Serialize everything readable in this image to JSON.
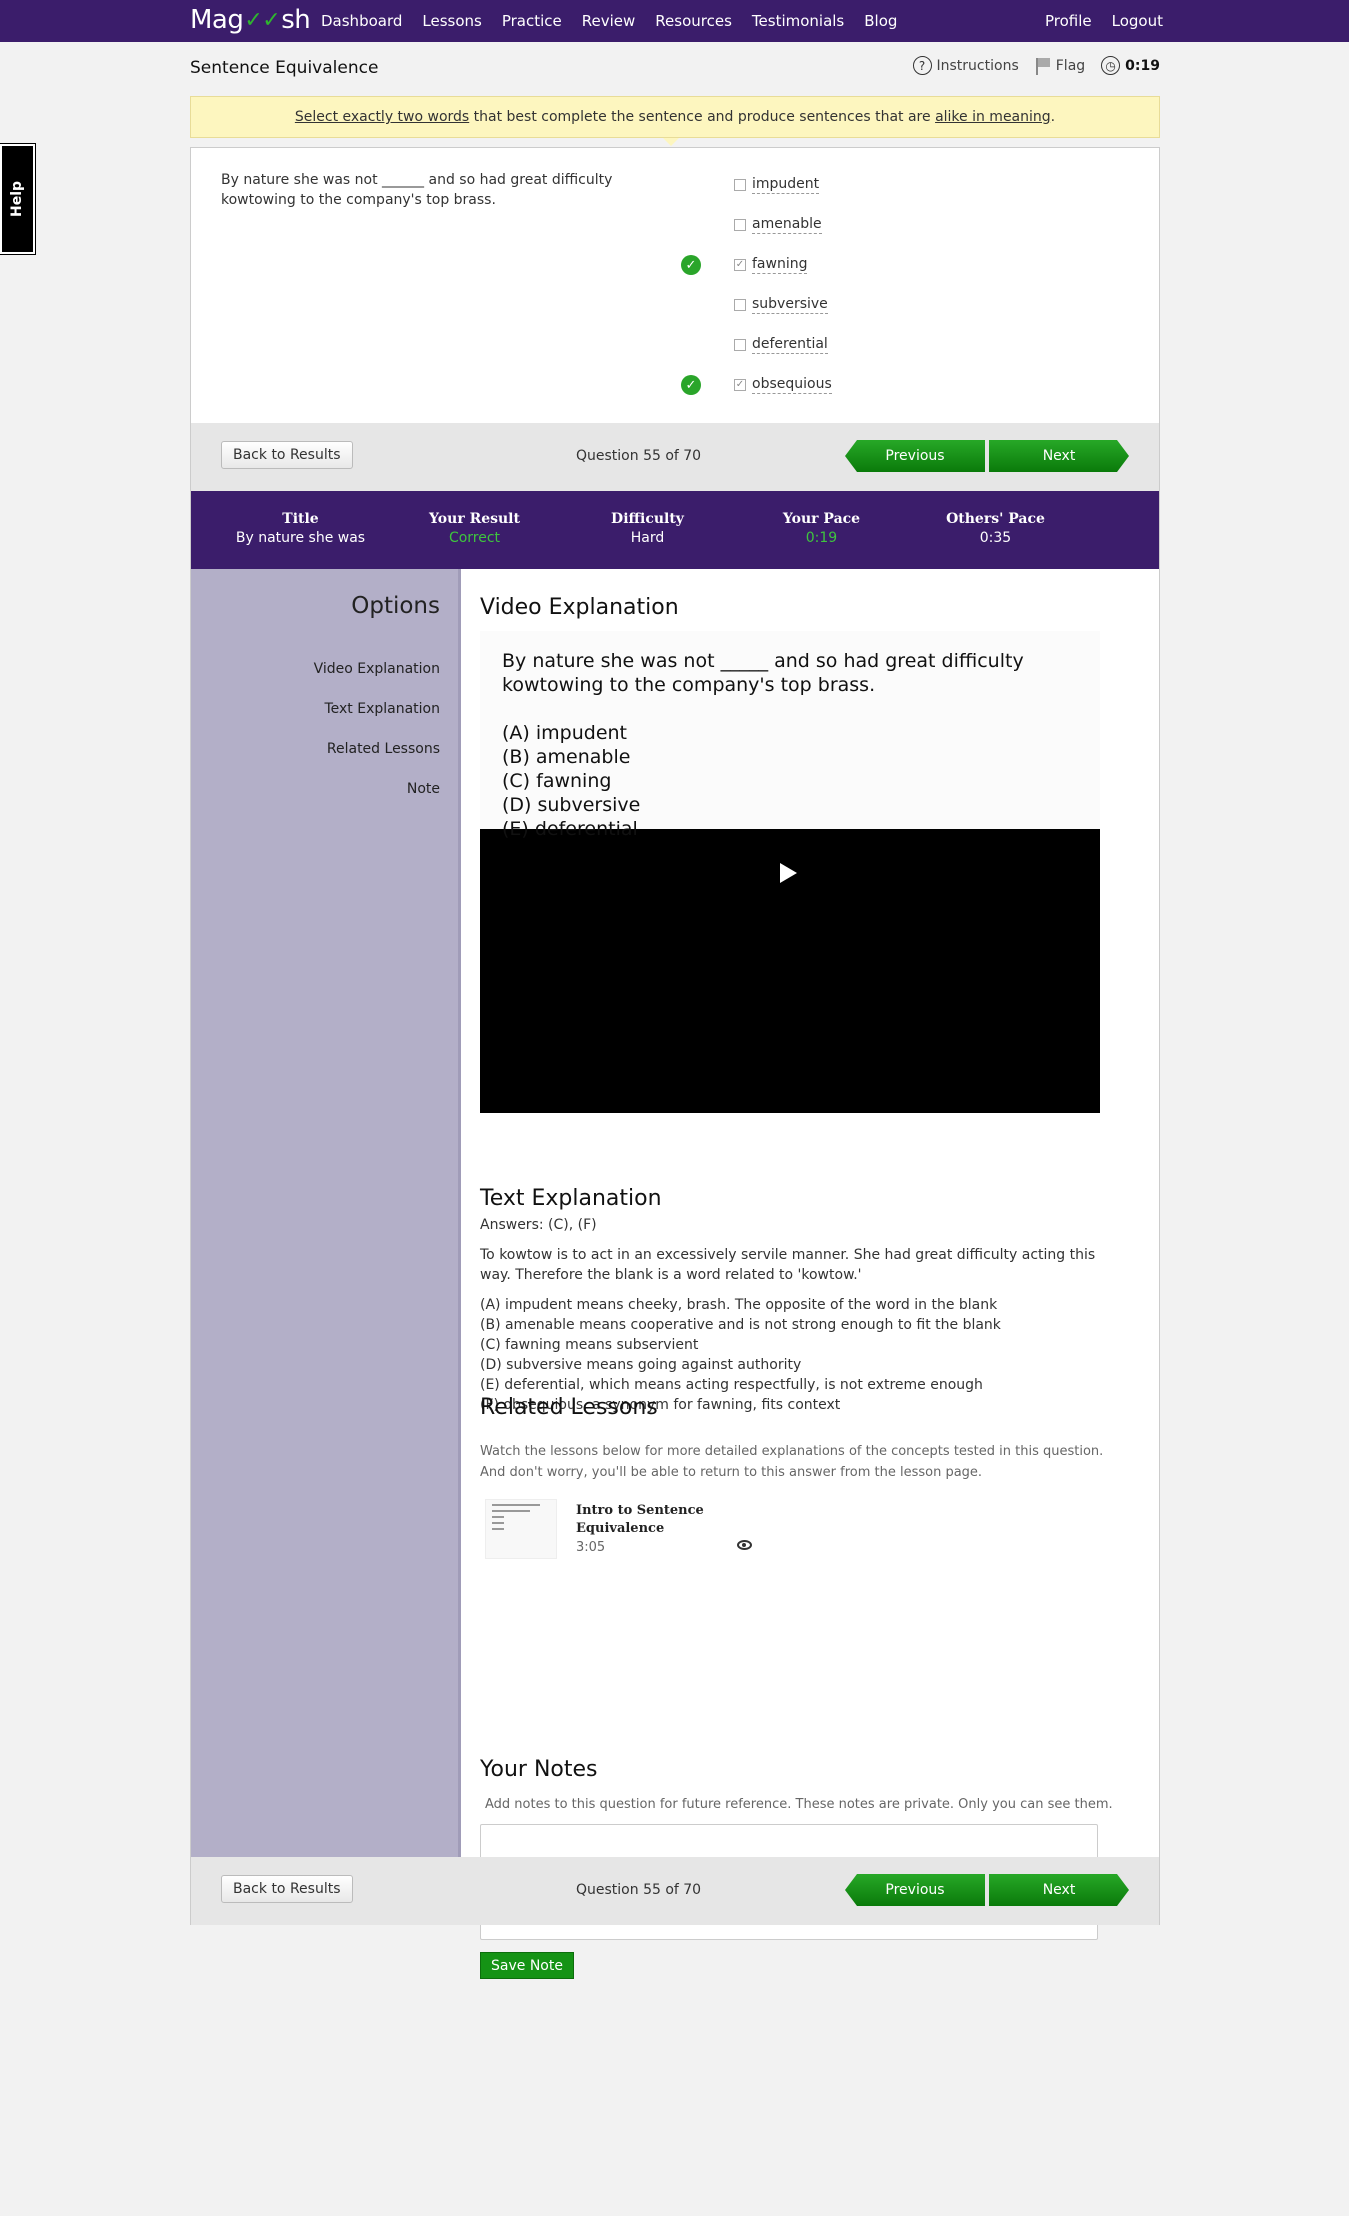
{
  "nav": {
    "logo_left": "Mag",
    "logo_right": "sh",
    "links": [
      "Dashboard",
      "Lessons",
      "Practice",
      "Review",
      "Resources",
      "Testimonials",
      "Blog"
    ],
    "right_links": [
      "Profile",
      "Logout"
    ]
  },
  "help_label": "Help",
  "header": {
    "title": "Sentence Equivalence",
    "instructions": "Instructions",
    "flag": "Flag",
    "timer": "0:19"
  },
  "banner": {
    "part1": "Select exactly two words",
    "part2": " that best complete the sentence and produce sentences that are ",
    "part3": "alike in meaning",
    "part4": "."
  },
  "question": {
    "stem": "By nature she was not ______ and so had great difficulty kowtowing to the company's top brass.",
    "choices": [
      {
        "label": "impudent",
        "checked": false,
        "correct": false
      },
      {
        "label": "amenable",
        "checked": false,
        "correct": false
      },
      {
        "label": "fawning",
        "checked": true,
        "correct": true
      },
      {
        "label": "subversive",
        "checked": false,
        "correct": false
      },
      {
        "label": "deferential",
        "checked": false,
        "correct": false
      },
      {
        "label": "obsequious",
        "checked": true,
        "correct": true
      }
    ]
  },
  "navigation": {
    "back": "Back to Results",
    "count": "Question 55 of 70",
    "previous": "Previous",
    "next": "Next"
  },
  "stats": {
    "title_h": "Title",
    "title_v": "By nature she was",
    "result_h": "Your Result",
    "result_v": "Correct",
    "difficulty_h": "Difficulty",
    "difficulty_v": "Hard",
    "pace_h": "Your Pace",
    "pace_v": "0:19",
    "others_h": "Others' Pace",
    "others_v": "0:35"
  },
  "options": {
    "heading": "Options",
    "items": [
      "Video Explanation",
      "Text Explanation",
      "Related Lessons",
      "Note"
    ]
  },
  "video": {
    "heading": "Video Explanation",
    "slide_stem": "By nature she was not _____ and so had great difficulty kowtowing to the company's top brass.",
    "slide_choices": [
      "(A) impudent",
      "(B) amenable",
      "(C) fawning",
      "(D) subversive",
      "(E) deferential"
    ]
  },
  "text_explanation": {
    "heading": "Text Explanation",
    "answers": "Answers: (C), (F)",
    "paragraph": "To kowtow is to act in an excessively servile manner. She had great difficulty acting this way. Therefore the blank is a word related to 'kowtow.'",
    "lines": [
      "(A) impudent means cheeky, brash. The opposite of the word in the blank",
      "(B) amenable means cooperative and is not strong enough to fit the blank",
      "(C) fawning means subservient",
      "(D) subversive means going against authority",
      "(E) deferential, which means acting respectfully, is not extreme enough",
      "(F) obsequious, a synonym for fawning, fits context"
    ]
  },
  "related": {
    "heading": "Related Lessons",
    "desc1": "Watch the lessons below for more detailed explanations of the concepts tested in this question.",
    "desc2": "And don't worry, you'll be able to return to this answer from the lesson page.",
    "lesson_title": "Intro to Sentence Equivalence",
    "lesson_duration": "3:05"
  },
  "notes": {
    "heading": "Your Notes",
    "desc": "Add notes to this question for future reference. These notes are private. Only you can see them.",
    "value": "",
    "save": "Save Note"
  }
}
